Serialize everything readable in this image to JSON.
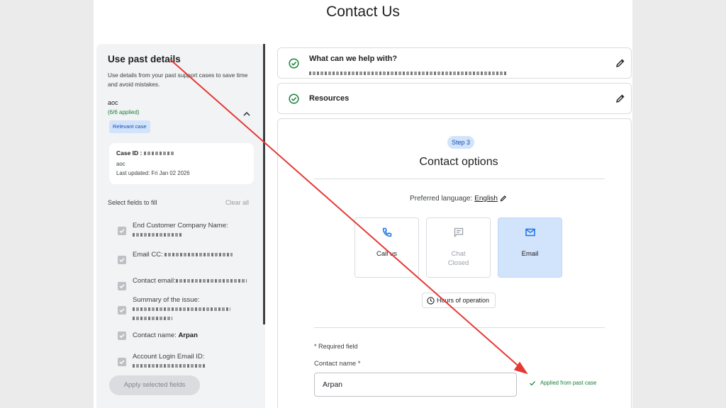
{
  "page": {
    "title": "Contact Us"
  },
  "sidebar": {
    "title": "Use past details",
    "description": "Use details from your past support cases to save time and avoid mistakes.",
    "case_name": "aoc",
    "applied_status": "(6/6 applied)",
    "badge": "Relevant case",
    "case_card": {
      "case_id_label": "Case ID :",
      "name": "aoc",
      "last_updated": "Last updated: Fri Jan 02 2026"
    },
    "select_fields_label": "Select fields to fill",
    "clear_all": "Clear all",
    "fields": [
      {
        "label": "End Customer Company Name:",
        "value": "",
        "checked": true
      },
      {
        "label": "Email CC:",
        "value": "",
        "checked": true
      },
      {
        "label": "Contact email:",
        "value": "",
        "checked": true
      },
      {
        "label": "Summary of the issue:",
        "value": "",
        "checked": true
      },
      {
        "label": "Contact name:",
        "value": "Arpan",
        "checked": true
      },
      {
        "label": "Account Login Email ID:",
        "value": "",
        "checked": true
      }
    ],
    "apply_button": "Apply selected fields"
  },
  "sections": [
    {
      "title": "What can we help with?",
      "status": "completed"
    },
    {
      "title": "Resources",
      "status": "completed"
    }
  ],
  "contact_options": {
    "step": "Step 3",
    "title": "Contact options",
    "preferred_language_label": "Preferred language:",
    "preferred_language": "English",
    "options": [
      {
        "label": "Call us",
        "sub": "",
        "icon": "phone-icon"
      },
      {
        "label": "Chat",
        "sub": "Closed",
        "icon": "chat-icon",
        "disabled": true
      },
      {
        "label": "Email",
        "sub": "",
        "icon": "email-icon",
        "selected": true
      }
    ],
    "hours_button": "Hours of operation",
    "required_note": "* Required field",
    "contact_name_label": "Contact name *",
    "contact_name_value": "Arpan",
    "applied_note": "Applied from past case"
  },
  "colors": {
    "accent_blue": "#1a73e8",
    "success_green": "#188038",
    "selected_tile": "#d2e3fc",
    "annotation_arrow": "#e53935"
  }
}
